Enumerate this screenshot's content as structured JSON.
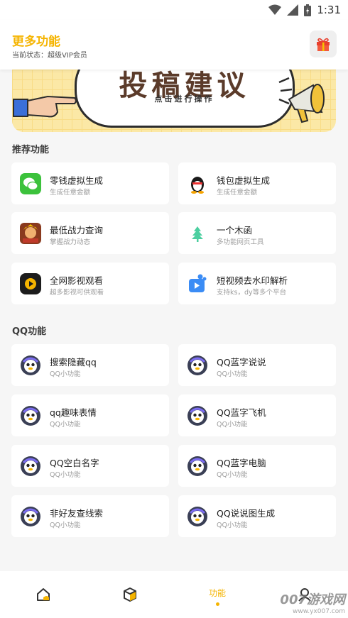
{
  "statusbar": {
    "time": "1:31",
    "icons": [
      "wifi-icon",
      "signal-icon",
      "battery-icon"
    ]
  },
  "header": {
    "title": "更多功能",
    "status_label": "当前状态：",
    "status_value": "超级VIP会员",
    "gift_icon": "gift-icon"
  },
  "banner": {
    "title": "投稿建议",
    "subtitle": "点击进行操作"
  },
  "recommended": {
    "title": "推荐功能",
    "items": [
      {
        "title": "零钱虚拟生成",
        "sub": "生成任意金额",
        "icon": "wechat-icon"
      },
      {
        "title": "钱包虚拟生成",
        "sub": "生成任意金额",
        "icon": "qq-penguin-icon"
      },
      {
        "title": "最低战力查询",
        "sub": "掌握战力动态",
        "icon": "game-hero-icon"
      },
      {
        "title": "一个木函",
        "sub": "多功能网页工具",
        "icon": "tree-icon"
      },
      {
        "title": "全网影视观看",
        "sub": "超多影视可供观看",
        "icon": "video-play-icon"
      },
      {
        "title": "短视频去水印解析",
        "sub": "支持ks，dy等多个平台",
        "icon": "video-parse-icon"
      }
    ]
  },
  "qq": {
    "title": "QQ功能",
    "items": [
      {
        "title": "搜索隐藏qq",
        "sub": "QQ小功能",
        "icon": "qq-avatar-icon"
      },
      {
        "title": "QQ蓝字说说",
        "sub": "QQ小功能",
        "icon": "qq-avatar-icon"
      },
      {
        "title": "qq趣味表情",
        "sub": "QQ小功能",
        "icon": "qq-avatar-icon"
      },
      {
        "title": "QQ蓝字飞机",
        "sub": "QQ小功能",
        "icon": "qq-avatar-icon"
      },
      {
        "title": "QQ空白名字",
        "sub": "QQ小功能",
        "icon": "qq-avatar-icon"
      },
      {
        "title": "QQ蓝字电脑",
        "sub": "QQ小功能",
        "icon": "qq-avatar-icon"
      },
      {
        "title": "非好友查线索",
        "sub": "QQ小功能",
        "icon": "qq-avatar-icon"
      },
      {
        "title": "QQ说说图生成",
        "sub": "QQ小功能",
        "icon": "qq-avatar-icon"
      }
    ]
  },
  "tabbar": {
    "tabs": [
      {
        "icon": "home-icon"
      },
      {
        "icon": "box-icon"
      },
      {
        "label": "功能",
        "active": true
      },
      {
        "icon": "user-icon"
      }
    ]
  },
  "watermark": {
    "big": "007游戏网",
    "small": "www.yx007.com"
  },
  "colors": {
    "accent": "#f5b400",
    "background": "#f6f6f6",
    "card": "#ffffff"
  }
}
